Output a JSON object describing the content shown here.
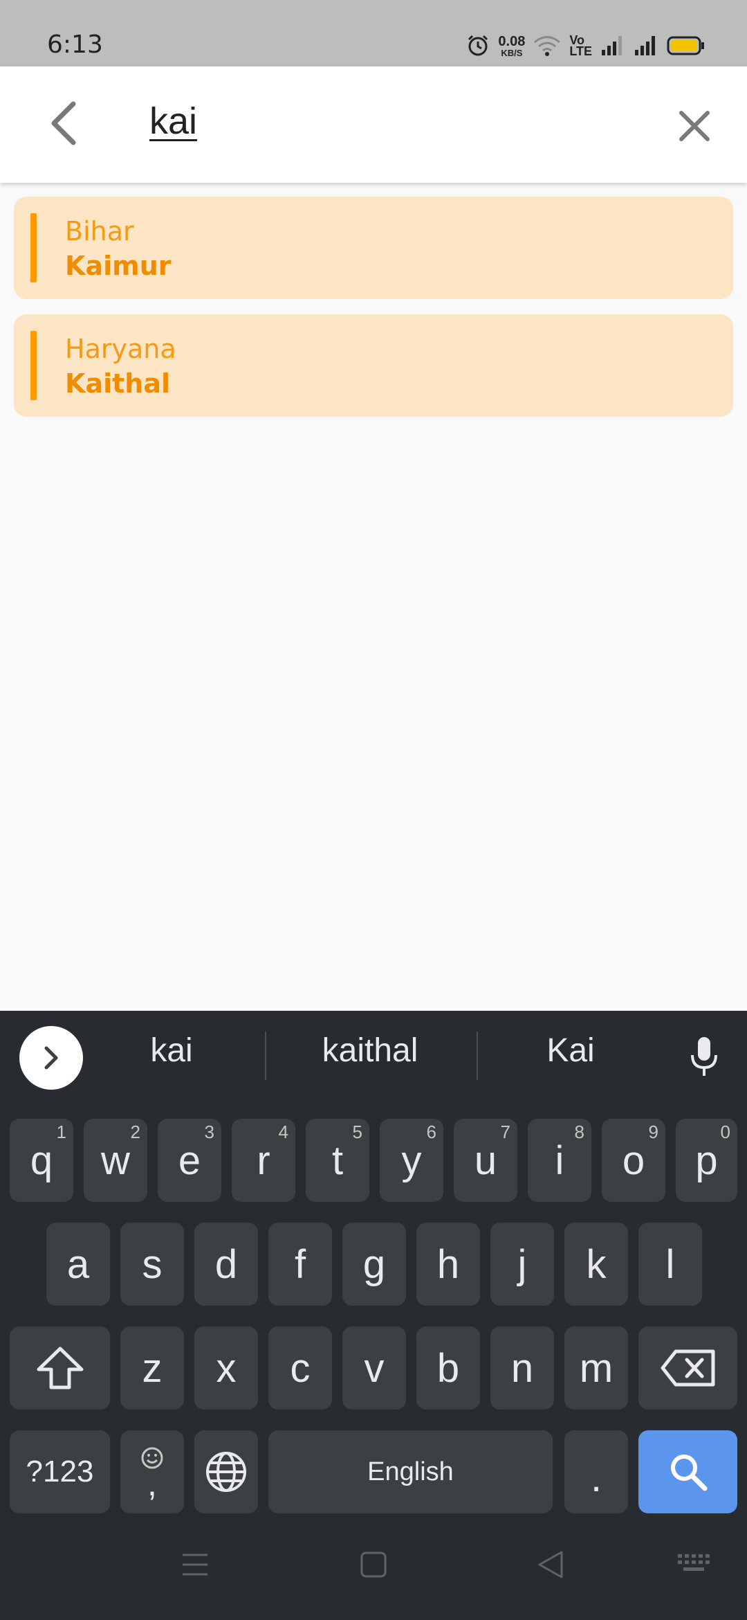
{
  "status_bar": {
    "time": "6:13",
    "net_speed_value": "0.08",
    "net_speed_unit": "KB/S",
    "volte_line1": "Vo",
    "volte_line2": "LTE",
    "icons": [
      "alarm-icon",
      "wifi-icon",
      "volte-icon",
      "signal-icon",
      "signal-icon",
      "battery-icon"
    ]
  },
  "search": {
    "value": "kai",
    "back_icon": "chevron-left-icon",
    "clear_icon": "close-icon"
  },
  "results": [
    {
      "state": "Bihar",
      "district": "Kaimur"
    },
    {
      "state": "Haryana",
      "district": "Kaithal"
    }
  ],
  "keyboard": {
    "suggestions": [
      "kai",
      "kaithal",
      "Kai"
    ],
    "row1": [
      {
        "key": "q",
        "hint": "1"
      },
      {
        "key": "w",
        "hint": "2"
      },
      {
        "key": "e",
        "hint": "3"
      },
      {
        "key": "r",
        "hint": "4"
      },
      {
        "key": "t",
        "hint": "5"
      },
      {
        "key": "y",
        "hint": "6"
      },
      {
        "key": "u",
        "hint": "7"
      },
      {
        "key": "i",
        "hint": "8"
      },
      {
        "key": "o",
        "hint": "9"
      },
      {
        "key": "p",
        "hint": "0"
      }
    ],
    "row2": [
      "a",
      "s",
      "d",
      "f",
      "g",
      "h",
      "j",
      "k",
      "l"
    ],
    "row3": [
      "z",
      "x",
      "c",
      "v",
      "b",
      "n",
      "m"
    ],
    "symbols_label": "?123",
    "comma_label": ",",
    "space_label": "English",
    "period_label": ".",
    "accent_color": "#5b95ec"
  },
  "colors": {
    "card_background": "#fbe5c4",
    "accent_orange": "#ff9a00",
    "keyboard_background": "#282c31"
  }
}
